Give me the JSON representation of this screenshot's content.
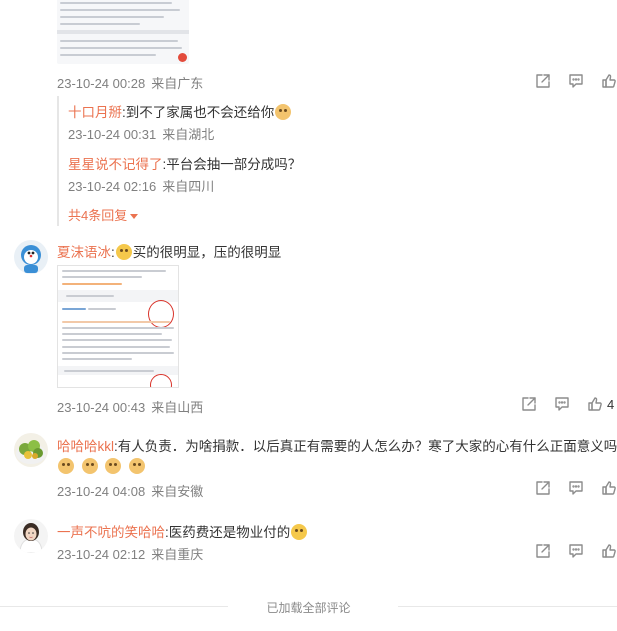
{
  "comments": [
    {
      "id": "c1",
      "time": "23-10-24 00:28",
      "location": "来自广东",
      "replies": [
        {
          "user": "十口月掰",
          "text": ":到不了家属也不会还给你",
          "emoji": "cat",
          "time": "23-10-24 00:31",
          "location": "来自湖北"
        },
        {
          "user": "星星说不记得了",
          "text": ":平台会抽一部分成吗？",
          "time": "23-10-24 02:16",
          "location": "来自四川"
        }
      ],
      "more_replies": "共4条回复"
    },
    {
      "id": "c2",
      "user": "夏沫语冰",
      "emoji_before": "grin",
      "text": "买的很明显，压的很明显",
      "time": "23-10-24 00:43",
      "location": "来自山西",
      "likes": "4"
    },
    {
      "id": "c3",
      "user": "哈哈哈kkl",
      "text": ":有人负责．为啥捐款．以后真正有需要的人怎么办？寒了大家的心有什么正面意义吗",
      "emoji_row_count": 4,
      "time": "23-10-24 04:08",
      "location": "来自安徽"
    },
    {
      "id": "c4",
      "user": "一声不吭的笑哈哈",
      "text": ":医药费还是物业付的",
      "emoji": "smile",
      "time": "23-10-24 02:12",
      "location": "来自重庆"
    }
  ],
  "footer": {
    "text": "已加载全部评论"
  },
  "colors": {
    "username": "#eb7350",
    "meta": "#808080",
    "text": "#333333",
    "icon": "#8c8c8c"
  }
}
